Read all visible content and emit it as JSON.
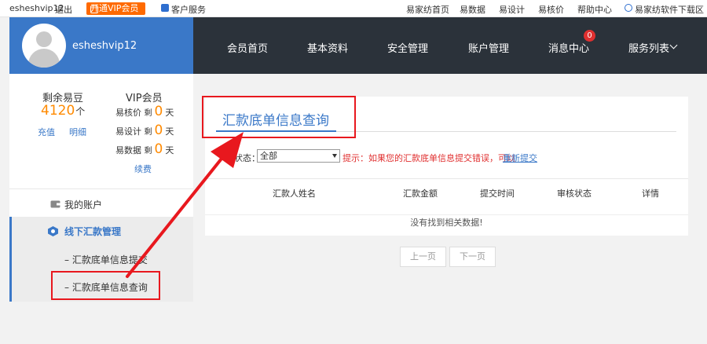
{
  "topbar": {
    "username": "esheshvip12",
    "logout": "退出",
    "vip_button": "开通VIP会员",
    "customer_service": "客户服务",
    "links": [
      "易家纺首页",
      "易数据",
      "易设计",
      "易核价",
      "帮助中心"
    ],
    "download": "易家纺软件下载区"
  },
  "header": {
    "username": "esheshvip12",
    "nav": [
      "会员首页",
      "基本资料",
      "安全管理",
      "账户管理",
      "消息中心",
      "服务列表"
    ],
    "message_badge": "0"
  },
  "sidebar": {
    "beans_title": "剩余易豆",
    "beans_value": "4120",
    "beans_unit": "个",
    "recharge": "充值",
    "details": "明细",
    "vip_title": "VIP会员",
    "vip_rows": [
      {
        "label": "易核价",
        "prefix": "剩",
        "value": "0",
        "unit": "天"
      },
      {
        "label": "易设计",
        "prefix": "剩",
        "value": "0",
        "unit": "天"
      },
      {
        "label": "易数据",
        "prefix": "剩",
        "value": "0",
        "unit": "天"
      }
    ],
    "renew": "续费",
    "menu": {
      "account": "我的账户",
      "offline": "线下汇款管理",
      "sub_submit": "– 汇款底单信息提交",
      "sub_query": "– 汇款底单信息查询"
    }
  },
  "content": {
    "title": "汇款底单信息查询",
    "status_label": "状态：",
    "status_value": "全部",
    "hint": "提示：如果您的汇款底单信息提交错误，可以",
    "hint_link": "重新提交",
    "columns": [
      "汇款人姓名",
      "汇款金额",
      "提交时间",
      "审核状态",
      "详情"
    ],
    "empty_message": "没有找到相关数据!",
    "prev_page": "上一页",
    "next_page": "下一页"
  },
  "colors": {
    "brand_blue": "#3a78c8",
    "nav_dark": "#2b323a",
    "accent_orange": "#ff8a00",
    "annotation_red": "#e8181e"
  }
}
